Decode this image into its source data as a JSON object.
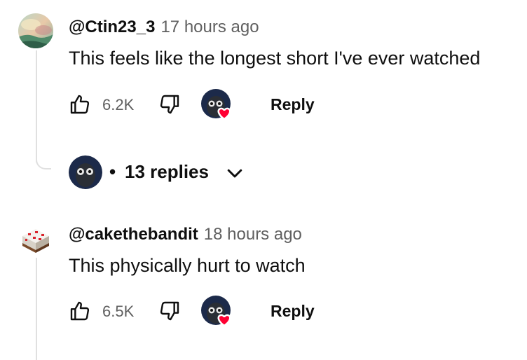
{
  "comments": [
    {
      "handle": "@Ctin23_3",
      "time": "17 hours ago",
      "text": "This feels like the longest short I've ever watched",
      "likes": "6.2K",
      "reply_label": "Reply",
      "avatar": "landscape-painting-avatar"
    },
    {
      "handle": "@cakethebandit",
      "time": "18 hours ago",
      "text": "This physically hurt to watch",
      "likes": "6.5K",
      "reply_label": "Reply",
      "avatar": "minecraft-cake-avatar"
    }
  ],
  "replies": {
    "separator": "•",
    "label": "13 replies"
  },
  "icons": {
    "like": "thumbs-up-icon",
    "dislike": "thumbs-down-icon",
    "creator_heart": "creator-heart-icon",
    "expand": "chevron-down-icon"
  },
  "colors": {
    "heart": "#ff0033",
    "secondary_text": "#606060",
    "thread_line": "#e0e0e0"
  }
}
